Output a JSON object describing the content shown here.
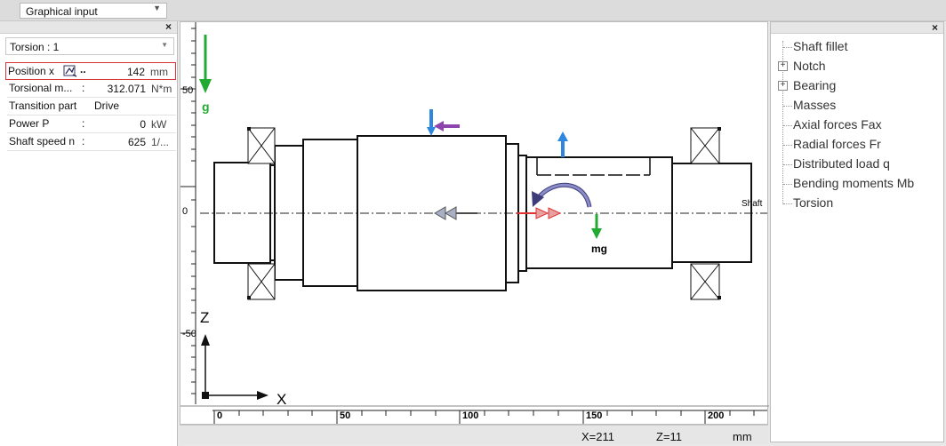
{
  "toolbar": {
    "mode_value": "Graphical input"
  },
  "left_panel": {
    "load_case": "Torsion : 1",
    "rows": [
      {
        "label": "Position x",
        "value": "142",
        "unit": "mm"
      },
      {
        "label": "Torsional m...",
        "colon": ":",
        "value": "312.071",
        "unit": "N*m"
      },
      {
        "label": "Transition part",
        "value": "Drive"
      },
      {
        "label": "Power P",
        "colon": ":",
        "value": "0",
        "unit": "kW"
      },
      {
        "label": "Shaft speed n",
        "colon": ":",
        "value": "625",
        "unit": "1/..."
      }
    ],
    "dots": ".."
  },
  "canvas": {
    "y_ticks": [
      "50",
      "0",
      "-50"
    ],
    "x_ticks": [
      "0",
      "50",
      "100",
      "150",
      "200"
    ],
    "gravity_label": "g",
    "weight_label": "mg",
    "shaft_label": "Shaft",
    "axis_x_label": "X",
    "axis_z_label": "Z"
  },
  "status": {
    "x_readout": "X=211",
    "z_readout": "Z=11",
    "unit": "mm"
  },
  "tree": {
    "items": [
      {
        "label": "Shaft fillet",
        "expandable": false
      },
      {
        "label": "Notch",
        "expandable": true
      },
      {
        "label": "Bearing",
        "expandable": true
      },
      {
        "label": "Masses",
        "expandable": false
      },
      {
        "label": "Axial forces Fax",
        "expandable": false
      },
      {
        "label": "Radial forces Fr",
        "expandable": false
      },
      {
        "label": "Distributed load q",
        "expandable": false
      },
      {
        "label": "Bending moments Mb",
        "expandable": false
      },
      {
        "label": "Torsion",
        "expandable": false
      }
    ]
  },
  "colors": {
    "selection_border": "#dd3333",
    "gravity_arrow": "#22aa33",
    "force_blue": "#2e86de",
    "force_purple": "#8e44ad"
  }
}
